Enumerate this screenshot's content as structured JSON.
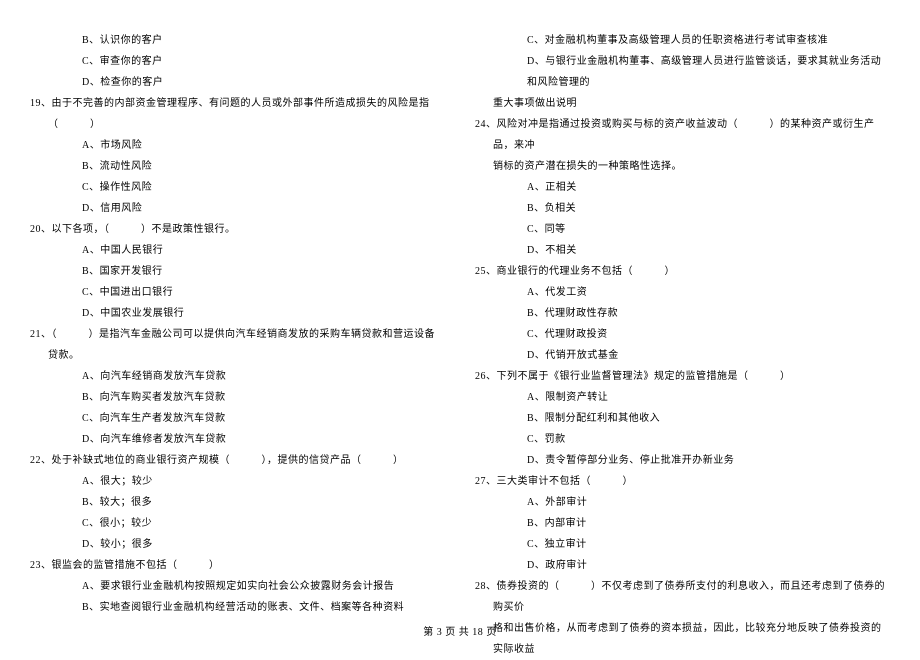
{
  "left": {
    "q18_options": [
      "B、认识你的客户",
      "C、审查你的客户",
      "D、检查你的客户"
    ],
    "q19": "19、由于不完善的内部资金管理程序、有问题的人员或外部事件所造成损失的风险是指（　　　）",
    "q19_options": [
      "A、市场风险",
      "B、流动性风险",
      "C、操作性风险",
      "D、信用风险"
    ],
    "q20": "20、以下各项，（　　　）不是政策性银行。",
    "q20_options": [
      "A、中国人民银行",
      "B、国家开发银行",
      "C、中国进出口银行",
      "D、中国农业发展银行"
    ],
    "q21": "21、（　　　）是指汽车金融公司可以提供向汽车经销商发放的采购车辆贷款和营运设备贷款。",
    "q21_options": [
      "A、向汽车经销商发放汽车贷款",
      "B、向汽车购买者发放汽车贷款",
      "C、向汽车生产者发放汽车贷款",
      "D、向汽车维修者发放汽车贷款"
    ],
    "q22": "22、处于补缺式地位的商业银行资产规模（　　　），提供的信贷产品（　　　）",
    "q22_options": [
      "A、很大；较少",
      "B、较大；很多",
      "C、很小；较少",
      "D、较小；很多"
    ],
    "q23": "23、银监会的监管措施不包括（　　　）",
    "q23_options": [
      "A、要求银行业金融机构按照规定如实向社会公众披露财务会计报告",
      "B、实地查阅银行业金融机构经营活动的账表、文件、档案等各种资料"
    ]
  },
  "right": {
    "q23_options_cont": [
      "C、对金融机构董事及高级管理人员的任职资格进行考试审查核准",
      "D、与银行业金融机构董事、高级管理人员进行监管谈话，要求其就业务活动和风险管理的"
    ],
    "q23_cont": "重大事项做出说明",
    "q24": "24、风险对冲是指通过投资或购买与标的资产收益波动（　　　）的某种资产或衍生产品，来冲",
    "q24_cont": "销标的资产潜在损失的一种策略性选择。",
    "q24_options": [
      "A、正相关",
      "B、负相关",
      "C、同等",
      "D、不相关"
    ],
    "q25": "25、商业银行的代理业务不包括（　　　）",
    "q25_options": [
      "A、代发工资",
      "B、代理财政性存款",
      "C、代理财政投资",
      "D、代销开放式基金"
    ],
    "q26": "26、下列不属于《银行业监督管理法》规定的监管措施是（　　　）",
    "q26_options": [
      "A、限制资产转让",
      "B、限制分配红利和其他收入",
      "C、罚款",
      "D、责令暂停部分业务、停止批准开办新业务"
    ],
    "q27": "27、三大类审计不包括（　　　）",
    "q27_options": [
      "A、外部审计",
      "B、内部审计",
      "C、独立审计",
      "D、政府审计"
    ],
    "q28": "28、债券投资的（　　　）不仅考虑到了债券所支付的利息收入，而且还考虑到了债券的购买价",
    "q28_cont": "格和出售价格，从而考虑到了债券的资本损益，因此，比较充分地反映了债券投资的实际收益"
  },
  "footer": "第 3 页 共 18 页"
}
